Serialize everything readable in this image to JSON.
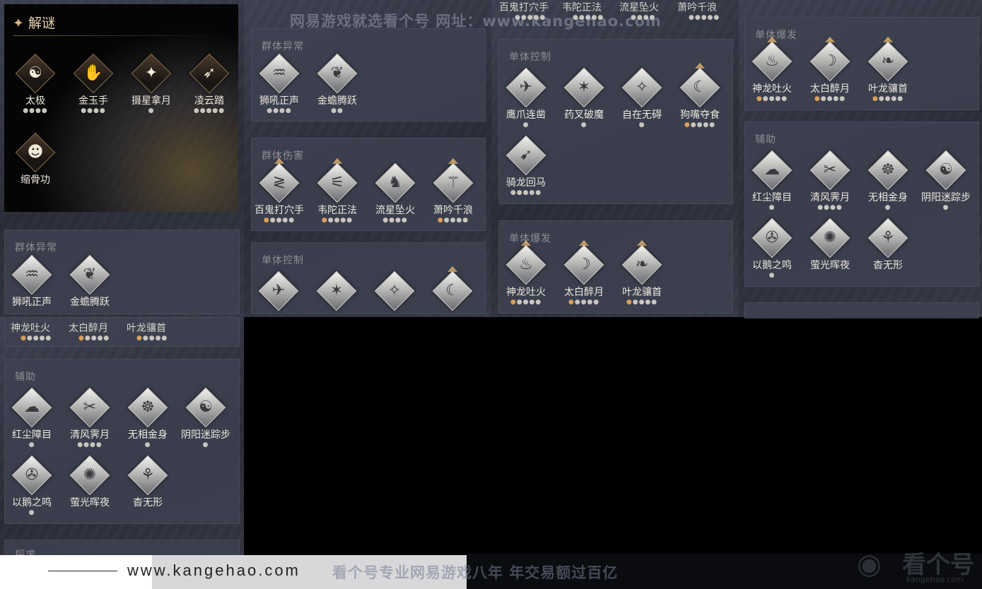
{
  "panels": {
    "puzzle": {
      "title": "解谜",
      "skills": [
        {
          "name": "太极",
          "dots": 4,
          "icon": "taiji-icon",
          "glyph": "☯"
        },
        {
          "name": "金玉手",
          "dots": 4,
          "icon": "jade-hand-icon",
          "glyph": "✋"
        },
        {
          "name": "摄星拿月",
          "dots": 1,
          "icon": "star-grab-icon",
          "glyph": "✦"
        },
        {
          "name": "凌云踏",
          "dots": 5,
          "icon": "cloud-step-icon",
          "glyph": "➶"
        },
        {
          "name": "缩骨功",
          "dots": 0,
          "icon": "bone-shrink-icon",
          "glyph": "☻"
        }
      ]
    },
    "group_abnormal": {
      "title": "群体异常",
      "skills": [
        {
          "name": "狮吼正声",
          "dots": 4,
          "icon": "lion-roar-icon",
          "glyph": "♒"
        },
        {
          "name": "金蟾腾跃",
          "dots": 2,
          "icon": "golden-toad-icon",
          "glyph": "❦"
        }
      ]
    },
    "group_damage": {
      "title": "群体伤害",
      "skills": [
        {
          "name": "百鬼打穴手",
          "dots": 5,
          "gold": 1,
          "tri": true,
          "icon": "hundred-ghost-icon",
          "glyph": "≷"
        },
        {
          "name": "韦陀正法",
          "dots": 5,
          "gold": 1,
          "tri": true,
          "icon": "weituo-icon",
          "glyph": "⚟"
        },
        {
          "name": "流星坠火",
          "dots": 4,
          "icon": "meteor-fire-icon",
          "glyph": "♞"
        },
        {
          "name": "萧吟千浪",
          "dots": 5,
          "gold": 1,
          "tri": true,
          "icon": "xiao-flute-icon",
          "glyph": "⚚"
        }
      ]
    },
    "single_control_b": {
      "title": "单体控制"
    },
    "single_control": {
      "title": "单体控制",
      "skills": [
        {
          "name": "鹰爪连凿",
          "dots": 1,
          "icon": "eagle-claw-icon",
          "glyph": "✈"
        },
        {
          "name": "药叉破魔",
          "dots": 1,
          "icon": "yaksha-icon",
          "glyph": "✶"
        },
        {
          "name": "自在无碍",
          "dots": 1,
          "icon": "free-spirit-icon",
          "glyph": "✧"
        },
        {
          "name": "狗嘴夺食",
          "dots": 5,
          "gold": 1,
          "tri": true,
          "icon": "dog-mouth-icon",
          "glyph": "☾"
        },
        {
          "name": "骑龙回马",
          "dots": 5,
          "icon": "dragon-ride-icon",
          "glyph": "➹"
        }
      ]
    },
    "single_burst_c": {
      "title": "单体爆发",
      "skills": [
        {
          "name": "神龙吐火",
          "dots": 5,
          "gold": 1,
          "tri": true,
          "icon": "dragon-fire-icon",
          "glyph": "♨"
        },
        {
          "name": "太白醉月",
          "dots": 5,
          "gold": 1,
          "tri": true,
          "icon": "drunk-moon-icon",
          "glyph": "☽"
        },
        {
          "name": "叶龙骧首",
          "dots": 5,
          "gold": 1,
          "tri": true,
          "icon": "leaf-dragon-icon",
          "glyph": "❧"
        }
      ]
    },
    "single_burst_d": {
      "title": "单体爆发",
      "skills": [
        {
          "name": "神龙吐火",
          "dots": 5,
          "gold": 1,
          "tri": true,
          "icon": "dragon-fire-icon",
          "glyph": "♨"
        },
        {
          "name": "太白醉月",
          "dots": 5,
          "gold": 1,
          "tri": true,
          "icon": "drunk-moon-icon",
          "glyph": "☽"
        },
        {
          "name": "叶龙骧首",
          "dots": 5,
          "gold": 1,
          "tri": true,
          "icon": "leaf-dragon-icon",
          "glyph": "❧"
        }
      ]
    },
    "support_d": {
      "title": "辅助",
      "skills": [
        {
          "name": "红尘障目",
          "dots": 1,
          "icon": "red-dust-icon",
          "glyph": "☁"
        },
        {
          "name": "清风霁月",
          "dots": 4,
          "icon": "breeze-icon",
          "glyph": "✂"
        },
        {
          "name": "无相金身",
          "dots": 1,
          "icon": "golden-body-icon",
          "glyph": "☸"
        },
        {
          "name": "阴阳迷踪步",
          "dots": 1,
          "icon": "yinyang-icon",
          "glyph": "☯"
        },
        {
          "name": "以鹅之鸣",
          "dots": 1,
          "icon": "goose-cry-icon",
          "glyph": "✇"
        },
        {
          "name": "萤光晖夜",
          "dots": 0,
          "icon": "firefly-icon",
          "glyph": "✺"
        },
        {
          "name": "杳无形",
          "dots": 0,
          "icon": "formless-icon",
          "glyph": "⚘"
        }
      ]
    },
    "support_e": {
      "title": "辅助",
      "skills": [
        {
          "name": "红尘障目",
          "dots": 1,
          "icon": "red-dust-icon",
          "glyph": "☁"
        },
        {
          "name": "清风霁月",
          "dots": 4,
          "icon": "breeze-icon",
          "glyph": "✂"
        },
        {
          "name": "无相金身",
          "dots": 1,
          "icon": "golden-body-icon",
          "glyph": "☸"
        },
        {
          "name": "阴阳迷踪步",
          "dots": 1,
          "icon": "yinyang-icon",
          "glyph": "☯"
        },
        {
          "name": "以鹅之鸣",
          "dots": 1,
          "icon": "goose-cry-icon",
          "glyph": "✇"
        },
        {
          "name": "萤光晖夜",
          "dots": 0,
          "icon": "firefly-icon",
          "glyph": "✺"
        },
        {
          "name": "杳无形",
          "dots": 0,
          "icon": "formless-icon",
          "glyph": "⚘"
        }
      ]
    },
    "group_abnormal_e": {
      "title": "群体异常",
      "skills": [
        {
          "name": "狮吼正声",
          "dots": 0,
          "icon": "lion-roar-icon",
          "glyph": "♒"
        },
        {
          "name": "金蟾腾跃",
          "dots": 0,
          "icon": "golden-toad-icon",
          "glyph": "❦"
        }
      ]
    },
    "cut_row_top": [
      "百鬼打穴手",
      "韦陀正法",
      "流星坠火",
      "萧吟千浪"
    ],
    "cut_row_e": [
      "神龙吐火",
      "太白醉月",
      "叶龙骧首"
    ],
    "cut_title_e": "探求"
  },
  "watermarks": {
    "top": "网易游戏就选看个号   网址：www.kangehao.com",
    "bottom": "看个号专业网易游戏八年  年交易额过百亿",
    "site": "www.kangehao.com",
    "logo": "看个号",
    "logo_sub": "kangehao.com"
  },
  "colors": {
    "gold": "#c9a46a",
    "panel": "#3e4250"
  }
}
